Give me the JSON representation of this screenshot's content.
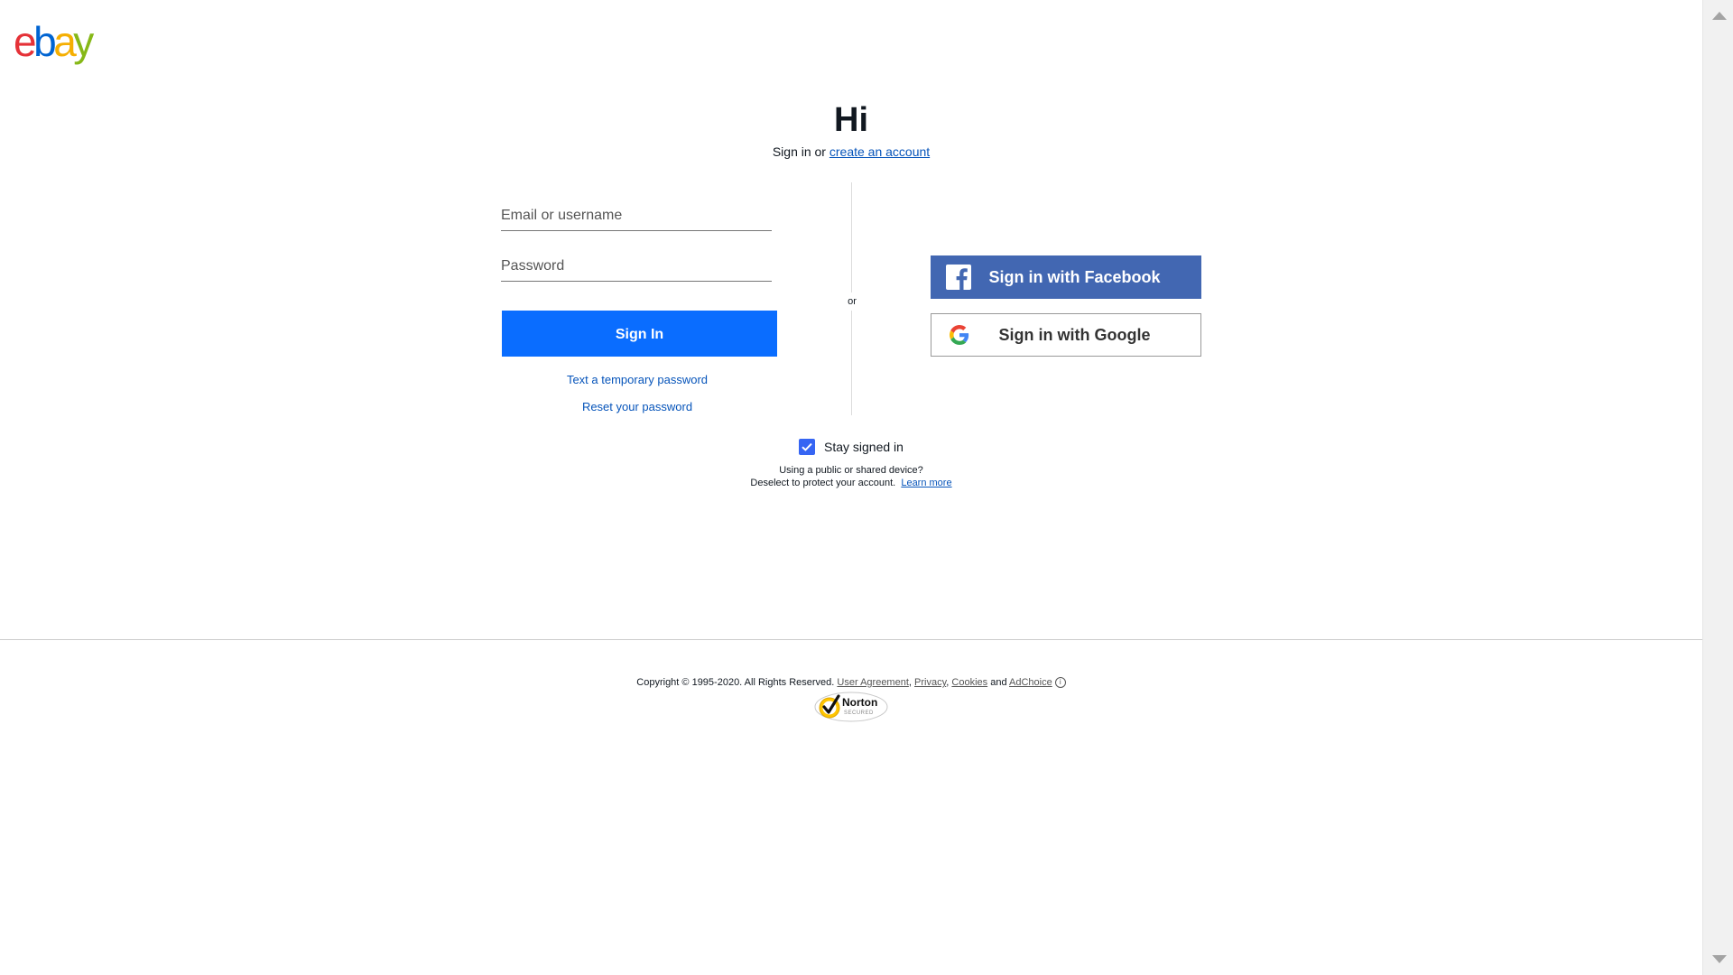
{
  "logo": {
    "letters": [
      "e",
      "b",
      "a",
      "y"
    ],
    "colors": [
      "#e53238",
      "#0064d2",
      "#f5af02",
      "#86b817"
    ]
  },
  "heading": {
    "title": "Hi",
    "prefix": "Sign in or",
    "create_link": "create an account"
  },
  "form": {
    "email_placeholder": "Email or username",
    "password_placeholder": "Password",
    "email_value": "",
    "password_value": "",
    "signin_label": "Sign In",
    "temp_password_link": "Text a temporary password",
    "reset_password_link": "Reset your password"
  },
  "divider": {
    "label": "or"
  },
  "social": {
    "facebook_label": "Sign in with Facebook",
    "facebook_icon": "facebook-icon",
    "google_label": "Sign in with Google",
    "google_icon": "google-icon",
    "facebook_color": "#4267b2"
  },
  "stay_signed_in": {
    "label": "Stay signed in",
    "checked": true,
    "note_line1": "Using a public or shared device?",
    "note_line2": "Deselect to protect your account.",
    "learn_more": "Learn more"
  },
  "footer": {
    "copyright": "Copyright © 1995-2020. All Rights Reserved.",
    "user_agreement": "User Agreement",
    "privacy": "Privacy",
    "cookies": "Cookies",
    "and": "and",
    "adchoice": "AdChoice",
    "norton_text": "Norton",
    "norton_sub": "SECURED"
  },
  "colors": {
    "primary_button": "#0a6dff",
    "link": "#0654ba",
    "checkbox": "#3665f3"
  }
}
